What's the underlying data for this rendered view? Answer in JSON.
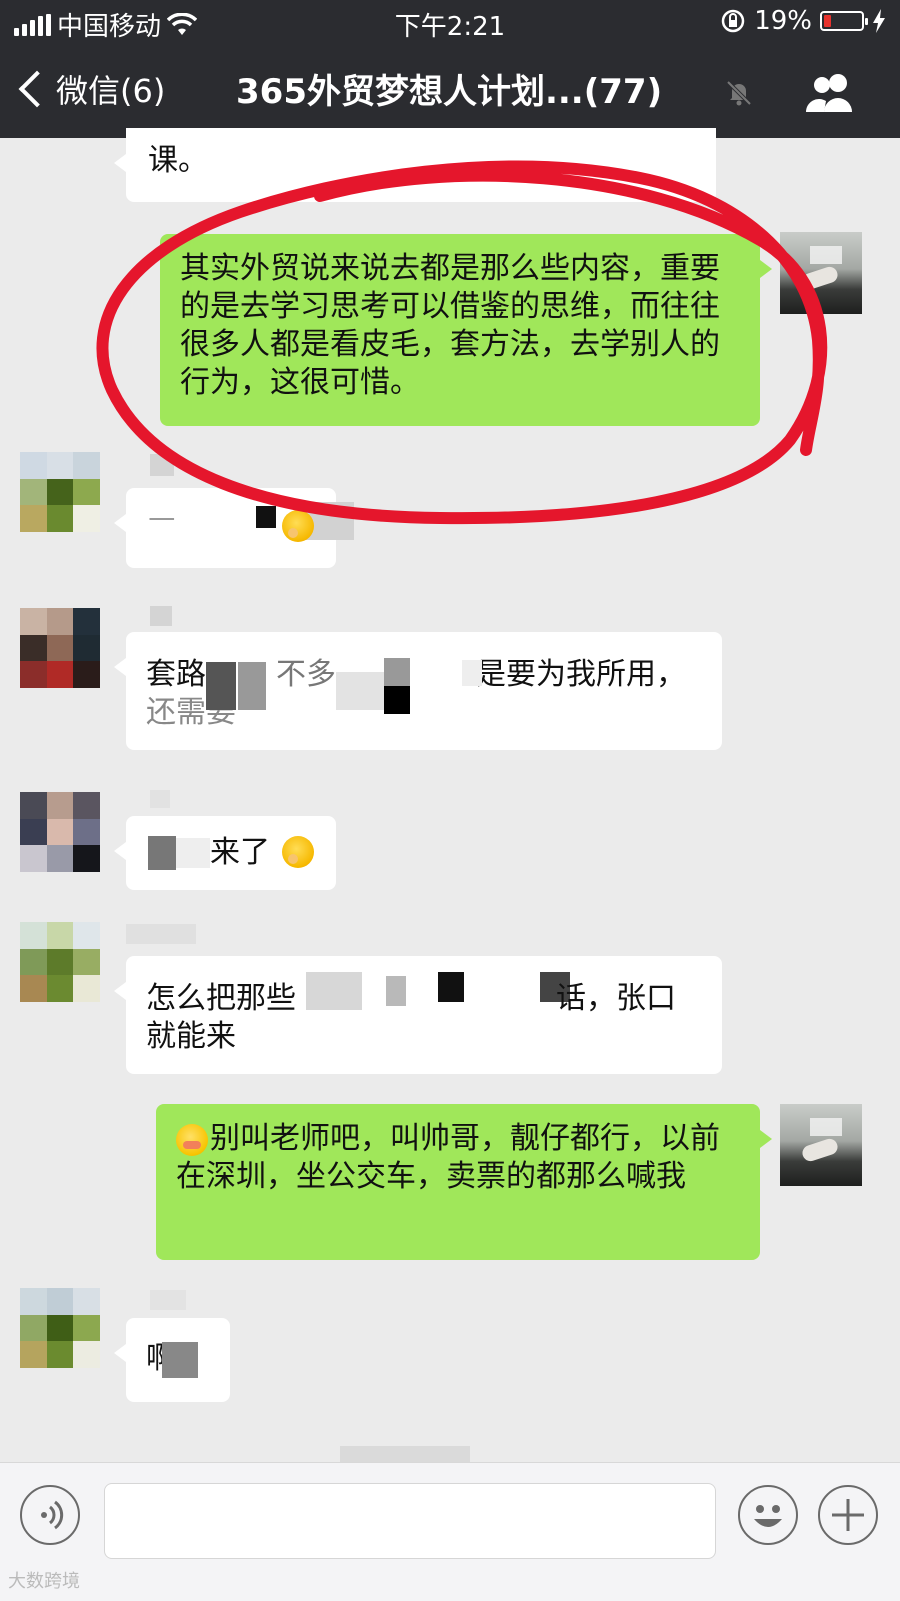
{
  "status": {
    "carrier": "中国移动",
    "time": "下午2:21",
    "battery": "19%",
    "battery_level": 0.19
  },
  "nav": {
    "back_label": "微信(6)",
    "title": "365外贸梦想人计划...(77)",
    "icons": {
      "back": "chevron-left-icon",
      "mute": "bell-off-icon",
      "group": "group-members-icon"
    }
  },
  "messages": [
    {
      "side": "left",
      "text": "课。"
    },
    {
      "side": "right",
      "text": "其实外贸说来说去都是那么些内容，重要的是去学习思考可以借鉴的思维，而往往很多人都是看皮毛，套方法，去学别人的行为，这很可惜。"
    },
    {
      "side": "left",
      "text_start": "ᅳ",
      "emoji": "hug-emoji"
    },
    {
      "side": "left",
      "text_start": "套路",
      "text_mid": "不多",
      "text_end": "是要为我所用，",
      "text_line2": "还需要"
    },
    {
      "side": "left",
      "text_end": "来了",
      "emoji": "hug-emoji"
    },
    {
      "side": "left",
      "text_start": "怎么把那些",
      "text_end": "话，张口",
      "text_line2": "就能来"
    },
    {
      "side": "right",
      "emoji": "flushed-emoji",
      "text": "别叫老师吧，叫帅哥，靓仔都行，以前在深圳，坐公交车，卖票的都那么喊我"
    },
    {
      "side": "left",
      "text_start": "啊"
    }
  ],
  "input_bar": {
    "icons": {
      "voice": "voice-icon",
      "emoji": "emoji-icon",
      "more": "plus-icon"
    }
  },
  "watermark": "大数跨境"
}
